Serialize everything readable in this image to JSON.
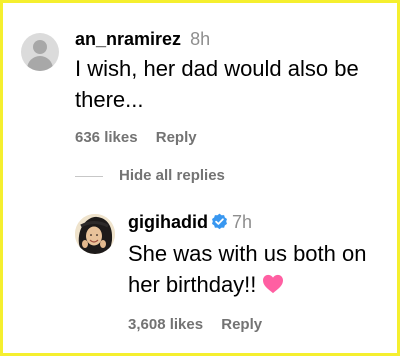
{
  "comment": {
    "username": "an_nramirez",
    "time": "8h",
    "text": "I wish, her dad would also be there...",
    "likes": "636 likes",
    "reply_label": "Reply"
  },
  "hide_replies_label": "Hide all replies",
  "reply": {
    "username": "gigihadid",
    "time": "7h",
    "text": "She was with us both on her birthday!!",
    "likes": "3,608 likes",
    "reply_label": "Reply",
    "verified_icon": "verified-badge-icon",
    "emoji_icon": "pink-heart-icon"
  },
  "colors": {
    "border": "#f5ef2f",
    "secondary_text": "#737373",
    "timestamp": "#8e8e8e",
    "verified": "#3897f0",
    "heart": "#ff5fa2"
  }
}
